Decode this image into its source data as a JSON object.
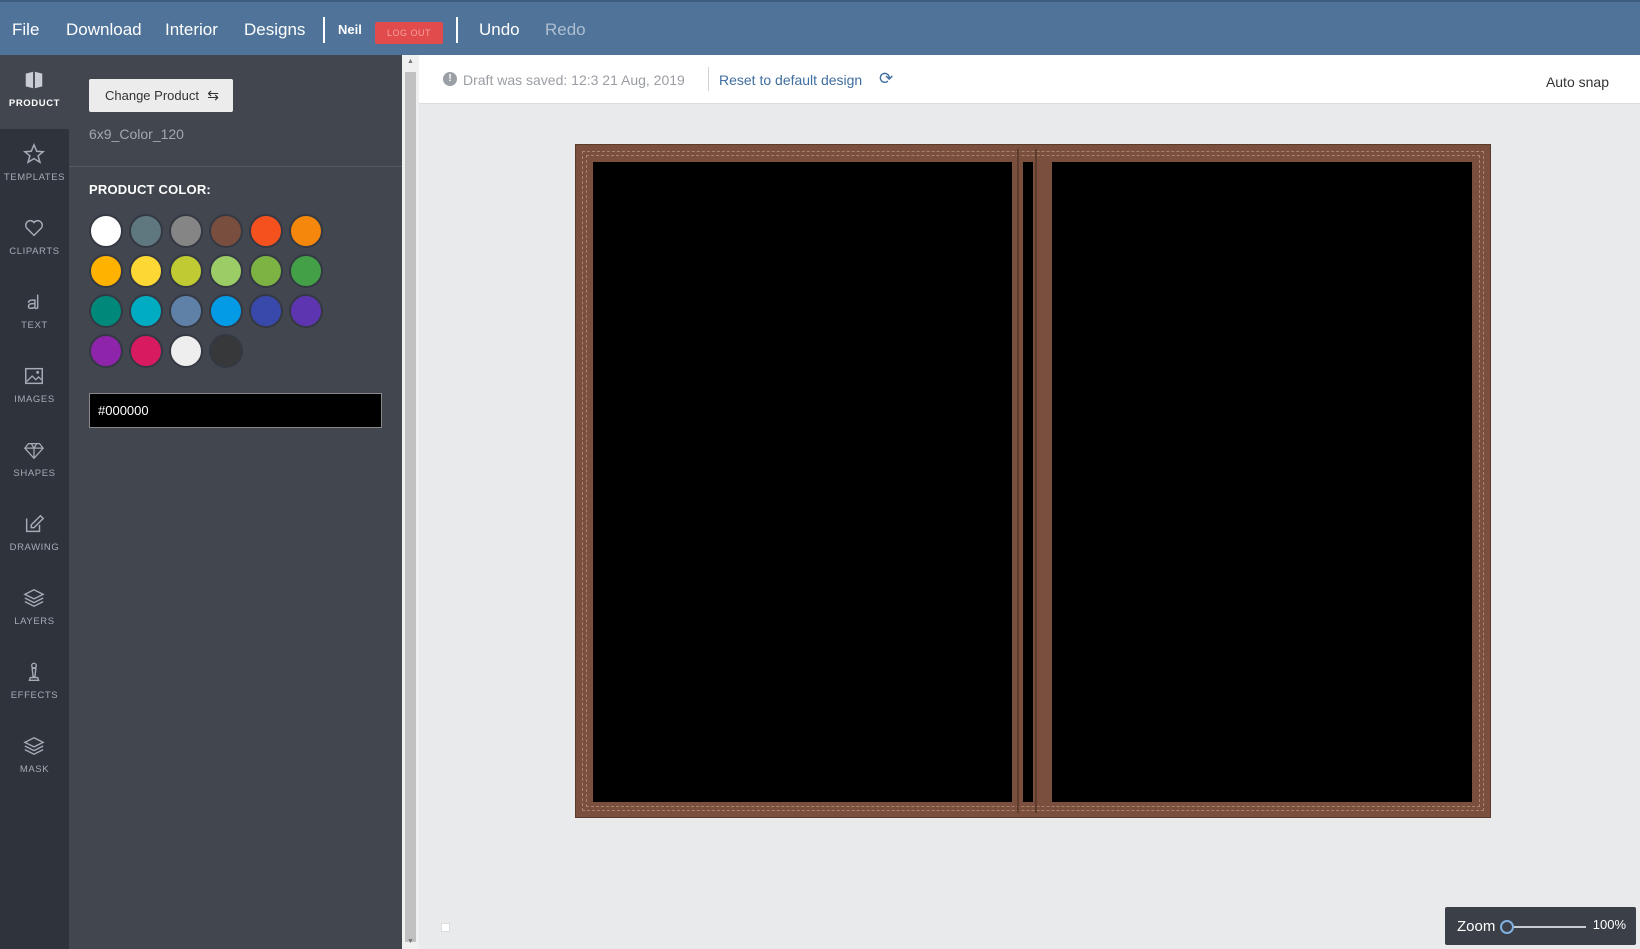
{
  "topbar": {
    "menu": [
      "File",
      "Download",
      "Interior",
      "Designs"
    ],
    "user_name": "Neil",
    "logout_label": "LOG OUT",
    "undo_label": "Undo",
    "redo_label": "Redo"
  },
  "rail": {
    "items": [
      {
        "label": "PRODUCT",
        "icon": "book-icon",
        "active": true
      },
      {
        "label": "TEMPLATES",
        "icon": "star-icon"
      },
      {
        "label": "CLIPARTS",
        "icon": "heart-icon"
      },
      {
        "label": "TEXT",
        "icon": "text-icon"
      },
      {
        "label": "IMAGES",
        "icon": "image-icon"
      },
      {
        "label": "SHAPES",
        "icon": "diamond-icon"
      },
      {
        "label": "DRAWING",
        "icon": "pencil-icon"
      },
      {
        "label": "LAYERS",
        "icon": "layers-icon"
      },
      {
        "label": "EFFECTS",
        "icon": "chess-icon"
      },
      {
        "label": "MASK",
        "icon": "mask-icon"
      }
    ]
  },
  "panel": {
    "change_product_label": "Change Product",
    "swap_icon": "swap-icon",
    "product_name": "6x9_Color_120",
    "color_heading": "PRODUCT COLOR:",
    "swatches": [
      "#ffffff",
      "#5f7880",
      "#858585",
      "#7a4e3e",
      "#f4511e",
      "#f5880c",
      "#ffb300",
      "#fdd835",
      "#c0ca33",
      "#9ccc65",
      "#7cb342",
      "#43a047",
      "#00897b",
      "#00acc1",
      "#5f81a8",
      "#039be5",
      "#3949ab",
      "#5e35b1",
      "#8e24aa",
      "#d81b60",
      "#eeeeee",
      "#37383a"
    ],
    "hex_value": "#000000"
  },
  "infobar": {
    "draft_text": "Draft was saved: 12:3 21 Aug, 2019",
    "reset_label": "Reset to default design",
    "auto_snap_label": "Auto snap"
  },
  "canvas": {
    "cover_color": "#7b4f3d",
    "page_color": "#000000"
  },
  "zoom": {
    "label": "Zoom",
    "value_label": "100%",
    "level": 0
  }
}
